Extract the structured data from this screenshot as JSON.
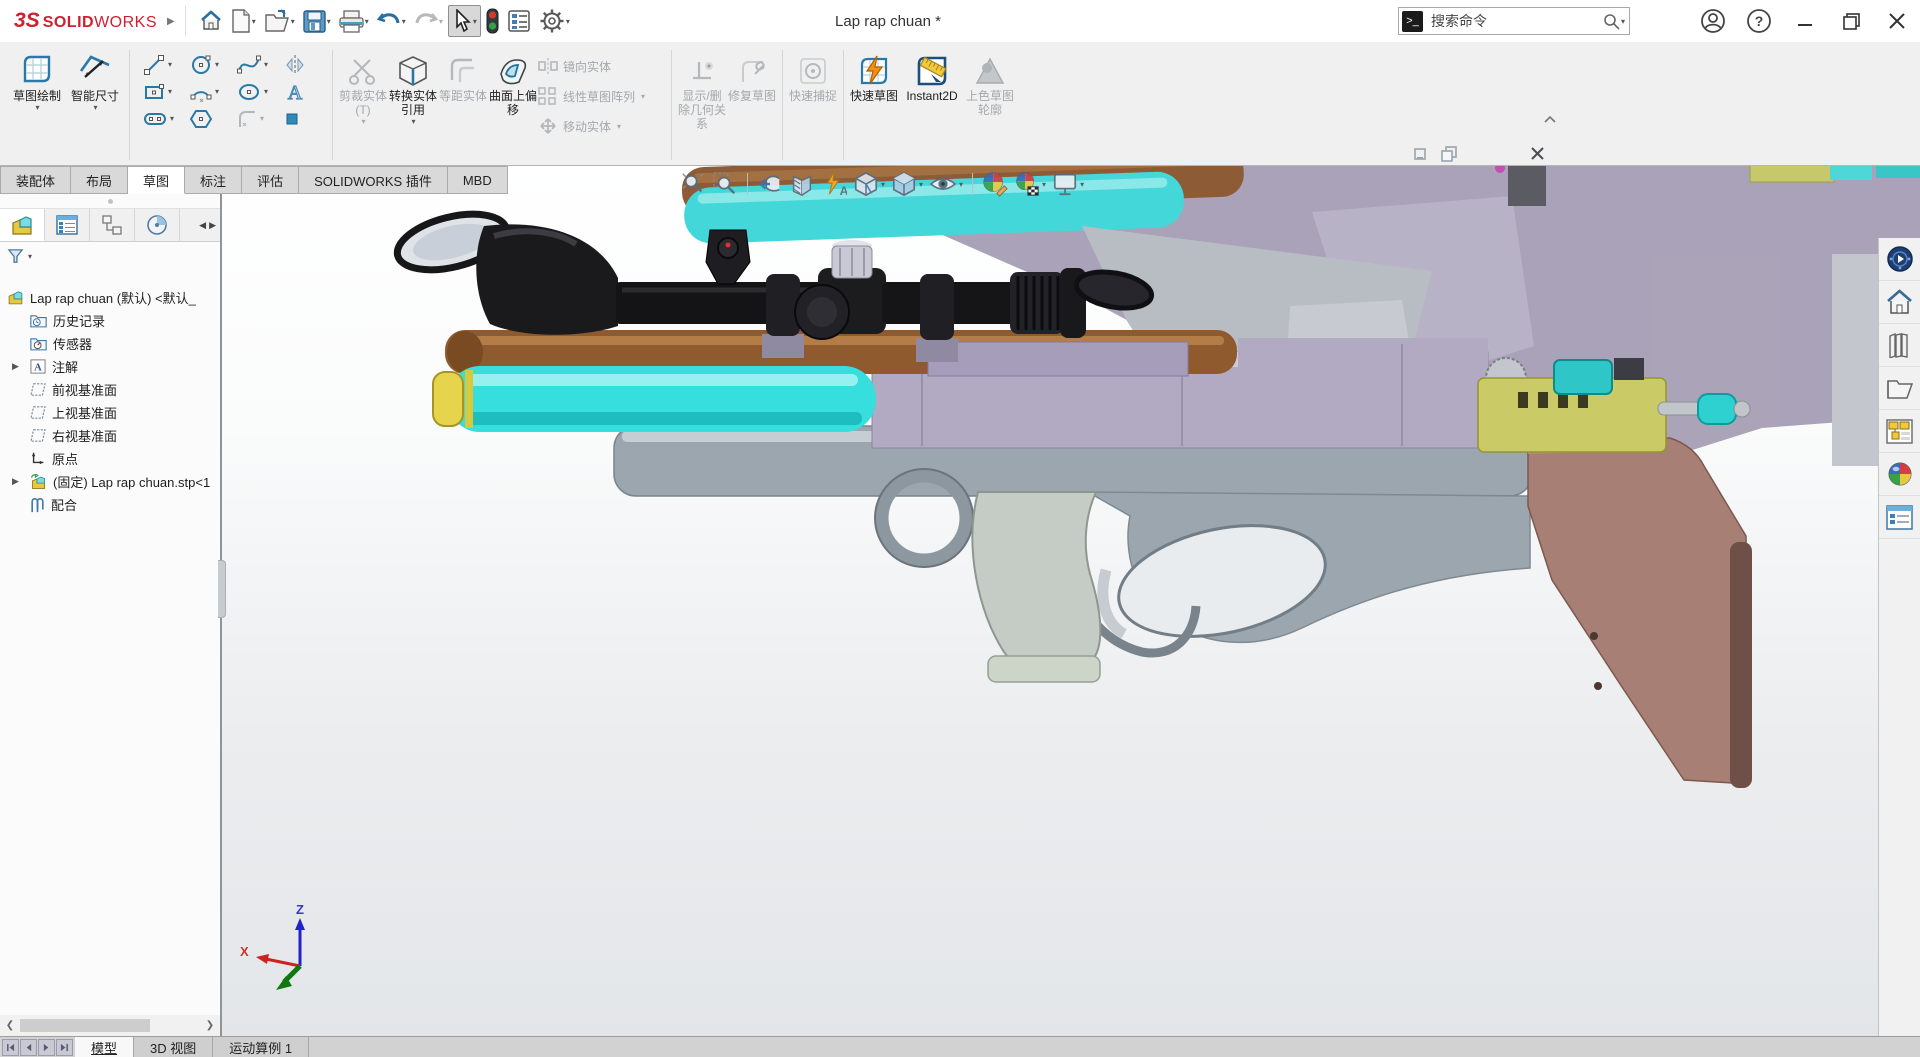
{
  "titlebar": {
    "brand_prefix": "3S",
    "brand_solid": "SOLID",
    "brand_works": "WORKS",
    "document_title": "Lap rap chuan *",
    "search_placeholder": "搜索命令",
    "quick_access_icons": [
      "home",
      "new-document",
      "open-document",
      "save",
      "print",
      "undo",
      "redo",
      "select-tool",
      "stoplight",
      "display-pane",
      "options-gear"
    ]
  },
  "ribbon": {
    "large_buttons": [
      {
        "label": "草图绘制",
        "enabled": true
      },
      {
        "label": "智能尺寸",
        "enabled": true
      }
    ],
    "stack_buttons": [
      {
        "label": "剪裁实体(T)",
        "enabled": false
      },
      {
        "label": "转换实体引用",
        "enabled": true
      },
      {
        "label": "等距实体",
        "enabled": false
      },
      {
        "label": "曲面上偏移",
        "enabled": true
      }
    ],
    "row_buttons": [
      {
        "label": "镜向实体",
        "enabled": false
      },
      {
        "label": "线性草图阵列",
        "enabled": false
      },
      {
        "label": "移动实体",
        "enabled": false
      }
    ],
    "right_buttons": [
      {
        "label": "显示/删除几何关系",
        "enabled": false
      },
      {
        "label": "修复草图",
        "enabled": false
      },
      {
        "label": "快速捕捉",
        "enabled": false
      },
      {
        "label": "快速草图",
        "enabled": true
      },
      {
        "label": "Instant2D",
        "enabled": true
      },
      {
        "label": "上色草图轮廓",
        "enabled": false
      }
    ],
    "tabs": [
      {
        "label": "装配体",
        "active": false
      },
      {
        "label": "布局",
        "active": false
      },
      {
        "label": "草图",
        "active": true
      },
      {
        "label": "标注",
        "active": false
      },
      {
        "label": "评估",
        "active": false
      },
      {
        "label": "SOLIDWORKS 插件",
        "active": false
      },
      {
        "label": "MBD",
        "active": false
      }
    ]
  },
  "feature_tree": {
    "root_label": "Lap rap chuan (默认) <默认_",
    "items": [
      {
        "label": "历史记录",
        "icon": "history-folder-icon",
        "expandable": false
      },
      {
        "label": "传感器",
        "icon": "sensors-folder-icon",
        "expandable": false
      },
      {
        "label": "注解",
        "icon": "annotations-icon",
        "expandable": true
      },
      {
        "label": "前视基准面",
        "icon": "plane-icon",
        "expandable": false
      },
      {
        "label": "上视基准面",
        "icon": "plane-icon",
        "expandable": false
      },
      {
        "label": "右视基准面",
        "icon": "plane-icon",
        "expandable": false
      },
      {
        "label": "原点",
        "icon": "origin-icon",
        "expandable": false
      },
      {
        "label": "(固定) Lap rap chuan.stp<1",
        "icon": "component-icon",
        "expandable": true
      },
      {
        "label": "配合",
        "icon": "mates-icon",
        "expandable": false
      }
    ]
  },
  "viewport": {
    "triad": {
      "z": "Z",
      "x": "X"
    },
    "hud_icons": [
      "zoom-to-fit",
      "zoom-to-area",
      "previous-view",
      "section-view",
      "annotation-visibility",
      "view-orientation",
      "display-style",
      "hide-show-items",
      "edit-appearance",
      "apply-scene",
      "view-settings"
    ],
    "model_colors": {
      "cylinder_cyan": "#38dede",
      "shroud_brown": "#8f5a2d",
      "receiver_lavender": "#b2aac2",
      "breech_yellow": "#caca66",
      "chassis_gray": "#9ba6ae",
      "stock_mauve": "#a87f74",
      "scope_black": "#1a1a1d",
      "background_instance_purple": "#a8a0b6"
    }
  },
  "taskpane_icons": [
    "3dexperience",
    "home",
    "design-library",
    "file-explorer",
    "view-palette",
    "appearances-scenes",
    "custom-properties"
  ],
  "bottom_tabs": [
    {
      "label": "模型",
      "active": true
    },
    {
      "label": "3D 视图",
      "active": false
    },
    {
      "label": "运动算例 1",
      "active": false
    }
  ],
  "colors": {
    "brand_red": "#cf2030",
    "accent_blue": "#2979a8"
  }
}
